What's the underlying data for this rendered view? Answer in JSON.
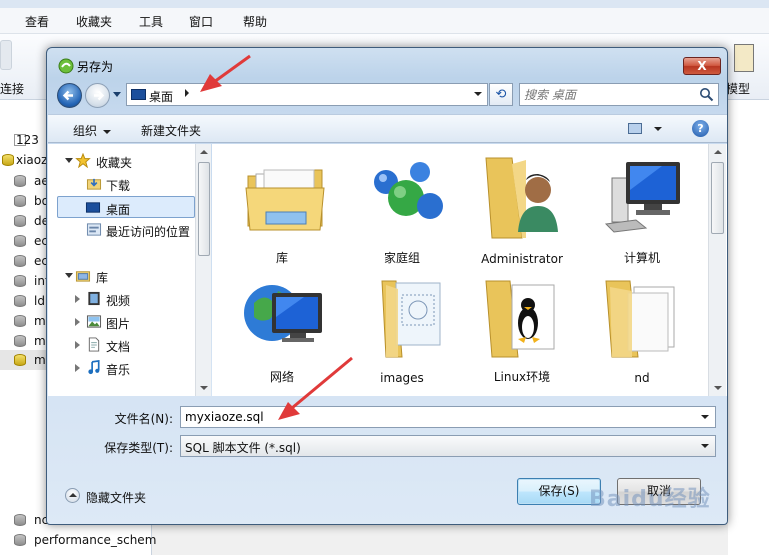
{
  "background_app": {
    "menu": [
      "查看",
      "收藏夹",
      "工具",
      "窗口",
      "帮助"
    ],
    "toolbar_left_label": "连接",
    "toolbar_right_label": "模型",
    "side_items": [
      "123",
      "xiaoz",
      "ae",
      "bo",
      "de",
      "ec",
      "ec",
      "inf",
      "ld",
      "my",
      "my",
      "my",
      "nc",
      "performance_schem"
    ]
  },
  "dialog": {
    "title": "另存为",
    "close_label": "X",
    "address": {
      "current": "桌面"
    },
    "search": {
      "placeholder": "搜索 桌面"
    },
    "toolbar": {
      "organize": "组织",
      "new_folder": "新建文件夹"
    },
    "nav": {
      "favorites_header": "收藏夹",
      "favorites": [
        "下载",
        "桌面",
        "最近访问的位置"
      ],
      "libraries_header": "库",
      "libraries": [
        "视频",
        "图片",
        "文档",
        "音乐"
      ]
    },
    "items": [
      {
        "label": "库",
        "icon": "library-folder-icon"
      },
      {
        "label": "家庭组",
        "icon": "homegroup-icon"
      },
      {
        "label": "Administrator",
        "icon": "user-folder-icon"
      },
      {
        "label": "计算机",
        "icon": "computer-icon"
      },
      {
        "label": "网络",
        "icon": "network-icon"
      },
      {
        "label": "images",
        "icon": "folder-icon"
      },
      {
        "label": "Linux环境",
        "icon": "folder-icon"
      },
      {
        "label": "nd",
        "icon": "folder-icon"
      }
    ],
    "filename": {
      "label": "文件名(N):",
      "value": "myxiaoze.sql"
    },
    "filetype": {
      "label": "保存类型(T):",
      "value": "SQL 脚本文件 (*.sql)"
    },
    "hide_folders": "隐藏文件夹",
    "save_button": "保存(S)",
    "cancel_button": "取消"
  },
  "watermark": "Baidu经验",
  "colors": {
    "annotation": "#e03a3a",
    "selection": "#dcebfc",
    "accent": "#3c7fb1"
  }
}
